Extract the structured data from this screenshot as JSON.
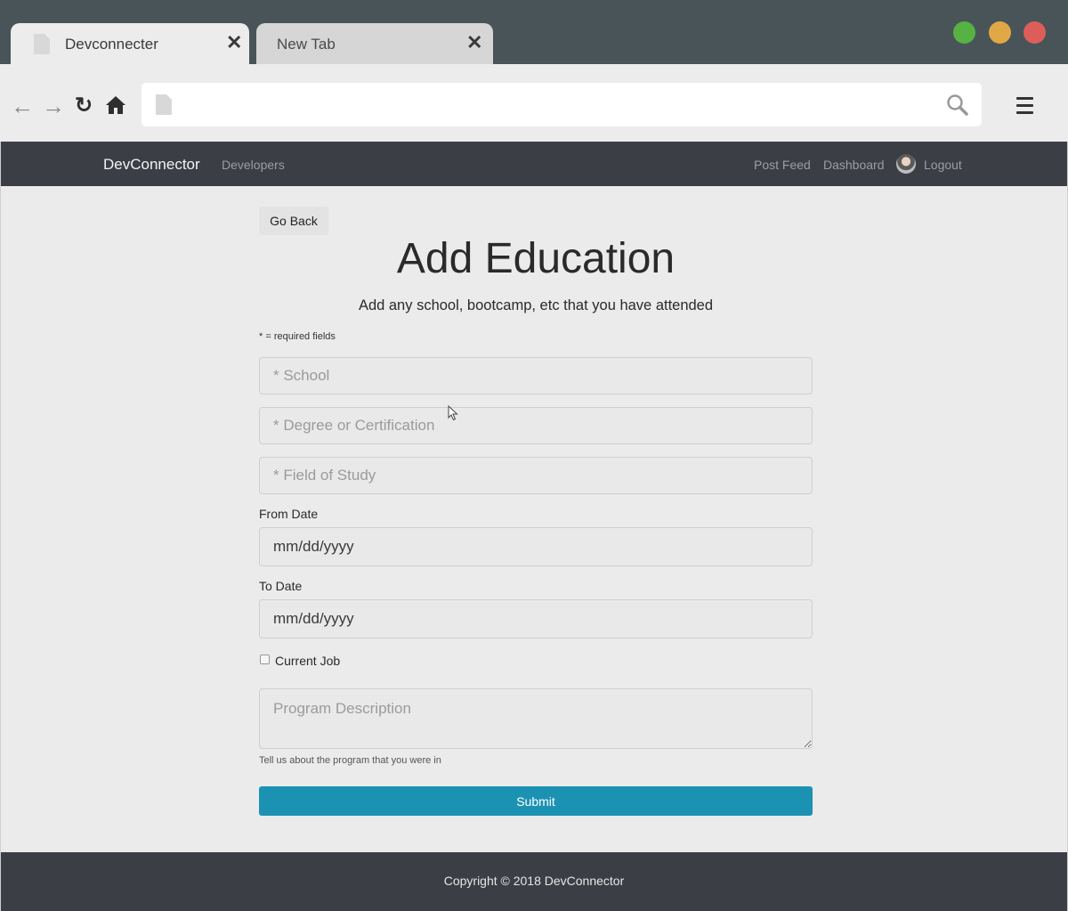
{
  "browser": {
    "tabs": [
      {
        "title": "Devconnecter",
        "close": "✕"
      },
      {
        "title": "New Tab",
        "close": "✕"
      }
    ],
    "nav_icons": {
      "back": "←",
      "forward": "→",
      "reload": "↻",
      "home": "⌂"
    },
    "address": {
      "value": "",
      "placeholder": ""
    },
    "window_buttons": {
      "close": "#dd5e59",
      "minimize": "#e0a845",
      "maximize": "#57b244"
    }
  },
  "navbar": {
    "brand": "DevConnector",
    "left_links": [
      "Developers"
    ],
    "right_links": [
      "Post Feed",
      "Dashboard"
    ],
    "logout": "Logout"
  },
  "page": {
    "go_back": "Go Back",
    "title": "Add Education",
    "lead": "Add any school, bootcamp, etc that you have attended",
    "required_note": "* = required fields"
  },
  "form": {
    "school": {
      "placeholder": "* School",
      "value": ""
    },
    "degree": {
      "placeholder": "* Degree or Certification",
      "value": ""
    },
    "field_of_study": {
      "placeholder": "* Field of Study",
      "value": ""
    },
    "from_date": {
      "label": "From Date",
      "value": "mm/dd/yyyy"
    },
    "to_date": {
      "label": "To Date",
      "value": "mm/dd/yyyy"
    },
    "current": {
      "label": "Current Job",
      "checked": false
    },
    "description": {
      "placeholder": "Program Description",
      "help": "Tell us about the program that you were in"
    },
    "submit": "Submit"
  },
  "footer": {
    "text": "Copyright © 2018 DevConnector"
  },
  "colors": {
    "navbar": "#3b3f45",
    "submit": "#1c92b3",
    "page_bg": "#ebebeb"
  }
}
